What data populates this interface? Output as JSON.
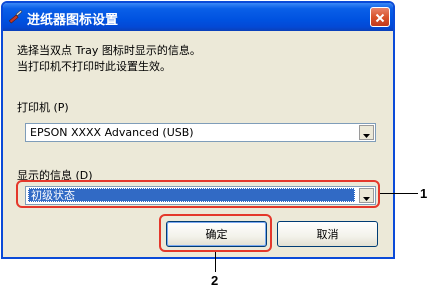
{
  "window": {
    "title": "进纸器图标设置",
    "title_icon": "wrench-icon",
    "close_icon": "close-icon"
  },
  "description": {
    "line1": "选择当双点 Tray 图标时显示的信息。",
    "line2": "当打印机不打印时此设置生效。"
  },
  "printer": {
    "label": "打印机 (P)",
    "selected": "EPSON XXXX Advanced (USB)"
  },
  "info": {
    "label": "显示的信息 (D)",
    "selected": "初级状态"
  },
  "buttons": {
    "ok_label": "确定",
    "cancel_label": "取消"
  },
  "callouts": {
    "one": "1",
    "two": "2"
  },
  "colors": {
    "titlebar": "#0052e0",
    "dialog_bg": "#ece9d8",
    "highlight": "#e4382b",
    "selection": "#316ac5"
  }
}
